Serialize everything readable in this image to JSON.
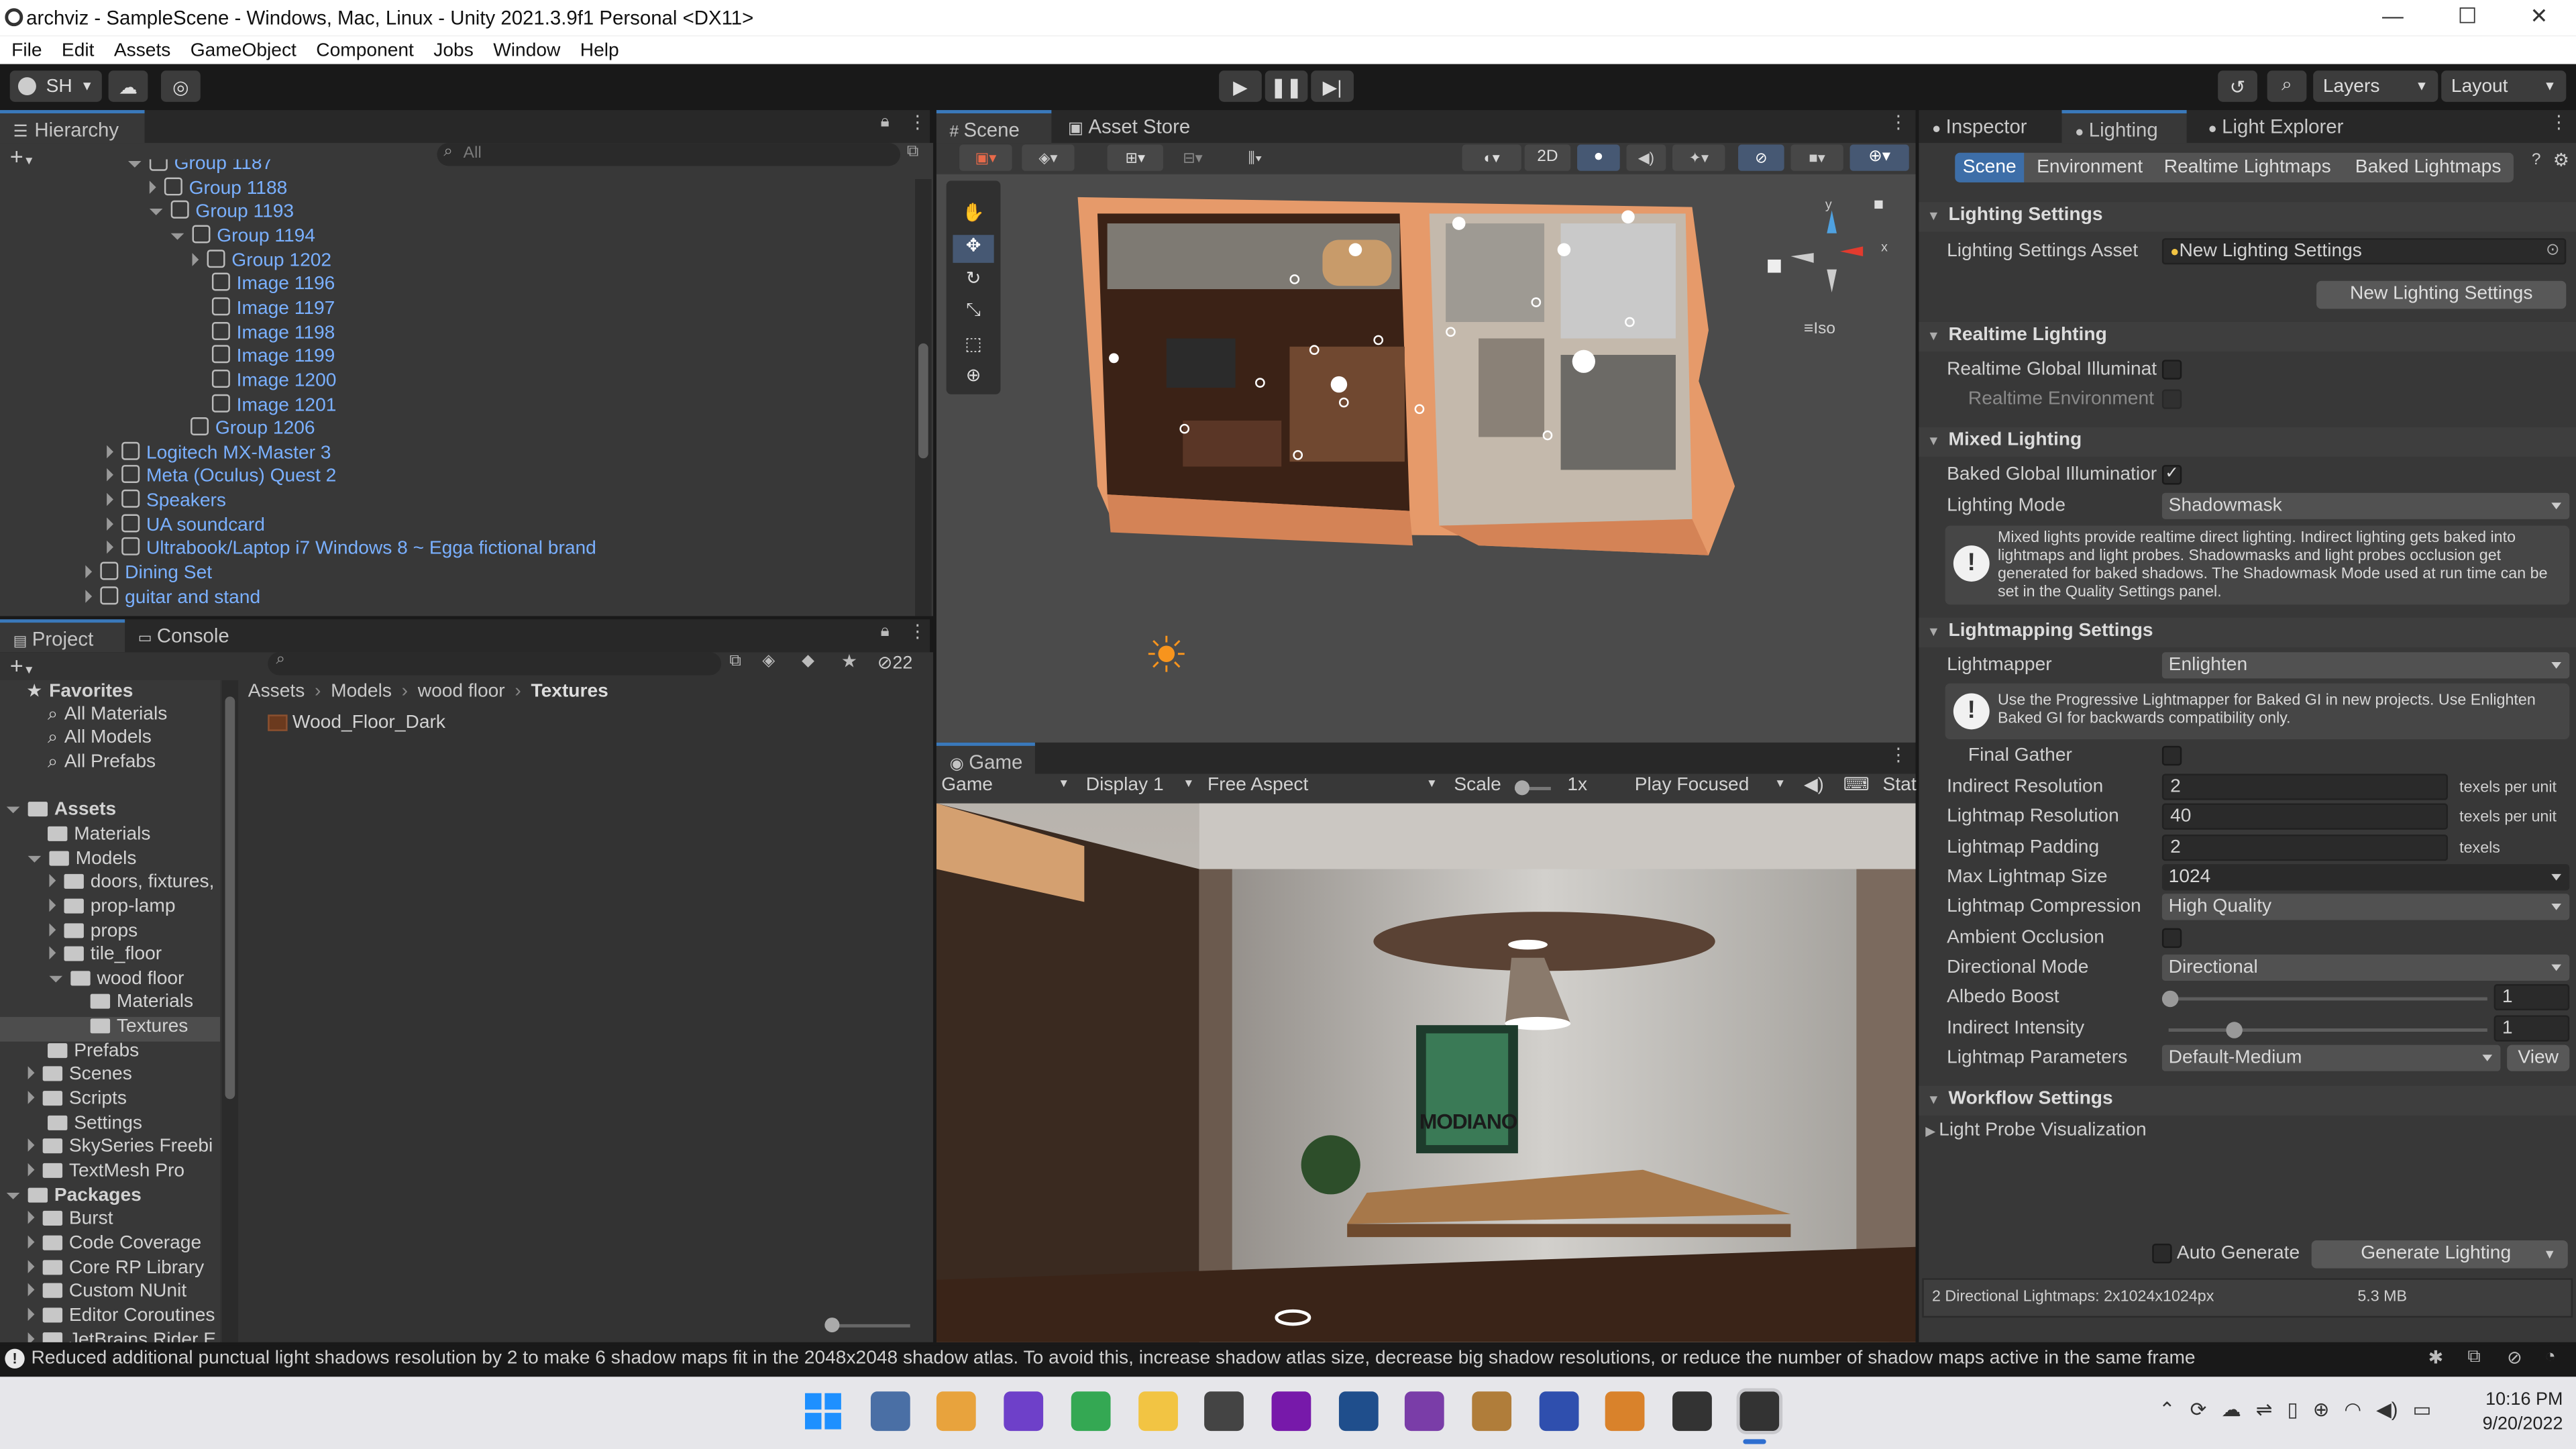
{
  "window": {
    "title": "archviz - SampleScene - Windows, Mac, Linux - Unity 2021.3.9f1 Personal <DX11>",
    "controls": [
      "—",
      "☐",
      "✕"
    ]
  },
  "menu": [
    "File",
    "Edit",
    "Assets",
    "GameObject",
    "Component",
    "Jobs",
    "Window",
    "Help"
  ],
  "toolbar": {
    "account": "SH",
    "layers": "Layers",
    "layout": "Layout"
  },
  "hierarchy": {
    "tab": "Hierarchy",
    "search_placeholder": "All",
    "items": [
      {
        "label": "Group 1187",
        "indent": 7,
        "expand": "down"
      },
      {
        "label": "Group 1188",
        "indent": 8,
        "expand": "right"
      },
      {
        "label": "Group 1193",
        "indent": 8,
        "expand": "down"
      },
      {
        "label": "Group 1194",
        "indent": 9,
        "expand": "down"
      },
      {
        "label": "Group 1202",
        "indent": 10,
        "expand": "right"
      },
      {
        "label": "Image 1196",
        "indent": 10,
        "expand": "none"
      },
      {
        "label": "Image 1197",
        "indent": 10,
        "expand": "none"
      },
      {
        "label": "Image 1198",
        "indent": 10,
        "expand": "none"
      },
      {
        "label": "Image 1199",
        "indent": 10,
        "expand": "none"
      },
      {
        "label": "Image 1200",
        "indent": 10,
        "expand": "none"
      },
      {
        "label": "Image 1201",
        "indent": 10,
        "expand": "none"
      },
      {
        "label": "Group 1206",
        "indent": 9,
        "expand": "none"
      },
      {
        "label": "Logitech MX-Master 3",
        "indent": 6,
        "expand": "right"
      },
      {
        "label": "Meta (Oculus) Quest 2",
        "indent": 6,
        "expand": "right"
      },
      {
        "label": "Speakers",
        "indent": 6,
        "expand": "right"
      },
      {
        "label": "UA soundcard",
        "indent": 6,
        "expand": "right"
      },
      {
        "label": "Ultrabook/Laptop i7 Windows 8 ~ Egga fictional brand",
        "indent": 6,
        "expand": "right"
      },
      {
        "label": "Dining Set",
        "indent": 5,
        "expand": "right"
      },
      {
        "label": "guitar and stand",
        "indent": 5,
        "expand": "right"
      }
    ]
  },
  "project": {
    "tabs": [
      "Project",
      "Console"
    ],
    "hidden_count": "22",
    "breadcrumb": [
      "Assets",
      "Models",
      "wood floor",
      "Textures"
    ],
    "files": [
      "Wood_Floor_Dark"
    ],
    "tree": [
      {
        "label": "Favorites",
        "indent": 0,
        "type": "star",
        "bold": true
      },
      {
        "label": "All Materials",
        "indent": 1,
        "type": "search"
      },
      {
        "label": "All Models",
        "indent": 1,
        "type": "search"
      },
      {
        "label": "All Prefabs",
        "indent": 1,
        "type": "search"
      },
      {
        "label": "",
        "indent": 0,
        "type": "gap"
      },
      {
        "label": "Assets",
        "indent": 0,
        "type": "folder",
        "bold": true,
        "expand": "down"
      },
      {
        "label": "Materials",
        "indent": 1,
        "type": "folder"
      },
      {
        "label": "Models",
        "indent": 1,
        "type": "folder",
        "expand": "down"
      },
      {
        "label": "doors, fixtures,",
        "indent": 2,
        "type": "folder",
        "expand": "right"
      },
      {
        "label": "prop-lamp",
        "indent": 2,
        "type": "folder",
        "expand": "right"
      },
      {
        "label": "props",
        "indent": 2,
        "type": "folder",
        "expand": "right"
      },
      {
        "label": "tile_floor",
        "indent": 2,
        "type": "folder",
        "expand": "right"
      },
      {
        "label": "wood floor",
        "indent": 2,
        "type": "folder",
        "expand": "down"
      },
      {
        "label": "Materials",
        "indent": 3,
        "type": "folder"
      },
      {
        "label": "Textures",
        "indent": 3,
        "type": "folder",
        "selected": true
      },
      {
        "label": "Prefabs",
        "indent": 1,
        "type": "folder"
      },
      {
        "label": "Scenes",
        "indent": 1,
        "type": "folder",
        "expand": "right"
      },
      {
        "label": "Scripts",
        "indent": 1,
        "type": "folder",
        "expand": "right"
      },
      {
        "label": "Settings",
        "indent": 1,
        "type": "folder"
      },
      {
        "label": "SkySeries Freebi",
        "indent": 1,
        "type": "folder",
        "expand": "right"
      },
      {
        "label": "TextMesh Pro",
        "indent": 1,
        "type": "folder",
        "expand": "right"
      },
      {
        "label": "Packages",
        "indent": 0,
        "type": "folder",
        "bold": true,
        "expand": "down"
      },
      {
        "label": "Burst",
        "indent": 1,
        "type": "folder",
        "expand": "right"
      },
      {
        "label": "Code Coverage",
        "indent": 1,
        "type": "folder",
        "expand": "right"
      },
      {
        "label": "Core RP Library",
        "indent": 1,
        "type": "folder",
        "expand": "right"
      },
      {
        "label": "Custom NUnit",
        "indent": 1,
        "type": "folder",
        "expand": "right"
      },
      {
        "label": "Editor Coroutines",
        "indent": 1,
        "type": "folder",
        "expand": "right"
      },
      {
        "label": "JetBrains Rider E",
        "indent": 1,
        "type": "folder",
        "expand": "right"
      }
    ]
  },
  "scene": {
    "tabs": [
      "Scene",
      "Asset Store"
    ],
    "toggle_2d": "2D",
    "gizmo_label": "Iso",
    "axis_y": "y",
    "axis_x": "x"
  },
  "game": {
    "tab": "Game",
    "display_mode": "Game",
    "display": "Display 1",
    "aspect": "Free Aspect",
    "scale_label": "Scale",
    "scale_value": "1x",
    "play_mode": "Play Focused",
    "stats": "Stat",
    "poster_text": "MODIANO"
  },
  "inspector": {
    "tabs": [
      "Inspector",
      "Lighting",
      "Light Explorer"
    ],
    "subtabs": [
      "Scene",
      "Environment",
      "Realtime Lightmaps",
      "Baked Lightmaps"
    ],
    "lighting_settings": {
      "header": "Lighting Settings",
      "asset_label": "Lighting Settings Asset",
      "asset_value": "New Lighting Settings",
      "new_button": "New Lighting Settings"
    },
    "realtime": {
      "header": "Realtime Lighting",
      "global_illum": "Realtime Global Illuminat",
      "environment": "Realtime Environment"
    },
    "mixed": {
      "header": "Mixed Lighting",
      "baked_gi": "Baked Global Illuminatior",
      "mode_label": "Lighting Mode",
      "mode_value": "Shadowmask",
      "help": "Mixed lights provide realtime direct lighting. Indirect lighting gets baked into lightmaps and light probes. Shadowmasks and light probes occlusion get generated for baked shadows. The Shadowmask Mode used at run time can be set in the Quality Settings panel."
    },
    "lightmapping": {
      "header": "Lightmapping Settings",
      "lightmapper_label": "Lightmapper",
      "lightmapper_value": "Enlighten",
      "help": "Use the Progressive Lightmapper for Baked GI in new projects. Use Enlighten Baked GI for backwards compatibility only.",
      "final_gather": "Final Gather",
      "indirect_res_label": "Indirect Resolution",
      "indirect_res_value": "2",
      "indirect_res_unit": "texels per unit",
      "lightmap_res_label": "Lightmap Resolution",
      "lightmap_res_value": "40",
      "lightmap_res_unit": "texels per unit",
      "padding_label": "Lightmap Padding",
      "padding_value": "2",
      "padding_unit": "texels",
      "max_size_label": "Max Lightmap Size",
      "max_size_value": "1024",
      "compression_label": "Lightmap Compression",
      "compression_value": "High Quality",
      "ao_label": "Ambient Occlusion",
      "dir_mode_label": "Directional Mode",
      "dir_mode_value": "Directional",
      "albedo_label": "Albedo Boost",
      "albedo_value": "1",
      "albedo_fraction": 0.0,
      "intensity_label": "Indirect Intensity",
      "intensity_value": "1",
      "intensity_fraction": 0.2,
      "params_label": "Lightmap Parameters",
      "params_value": "Default-Medium",
      "view_button": "View"
    },
    "workflow": {
      "header": "Workflow Settings",
      "probe_vis": "Light Probe Visualization"
    },
    "auto_generate": "Auto Generate",
    "generate_button": "Generate Lighting",
    "footer_left": "2 Directional Lightmaps: 2x1024x1024px",
    "footer_right": "5.3 MB"
  },
  "status": {
    "message": "Reduced additional punctual light shadows resolution by 2 to make 6 shadow maps fit in the 2048x2048 shadow atlas. To avoid this, increase shadow atlas size, decrease big shadow resolutions, or reduce the number of shadow maps active in the same frame"
  },
  "taskbar": {
    "time": "10:16 PM",
    "date": "9/20/2022",
    "apps": [
      {
        "name": "windows-start-icon",
        "color": "#1e90ff"
      },
      {
        "name": "calculator-icon",
        "color": "#4a6fa5"
      },
      {
        "name": "sourcetree-icon",
        "color": "#e8a33d"
      },
      {
        "name": "github-icon",
        "color": "#6e40c9"
      },
      {
        "name": "chrome-icon",
        "color": "#34a853"
      },
      {
        "name": "file-explorer-icon",
        "color": "#f2c443"
      },
      {
        "name": "unity-hub-icon",
        "color": "#444444"
      },
      {
        "name": "onenote-icon",
        "color": "#7719aa"
      },
      {
        "name": "substance-icon",
        "color": "#1f4e8c"
      },
      {
        "name": "affinity-photo-icon",
        "color": "#7a3da8"
      },
      {
        "name": "sonos-icon",
        "color": "#b07d3a"
      },
      {
        "name": "affinity-designer-icon",
        "color": "#2f4fae"
      },
      {
        "name": "chrome-dev-icon",
        "color": "#d9822b"
      },
      {
        "name": "unity-icon",
        "color": "#333333"
      },
      {
        "name": "unity-active-icon",
        "color": "#333333"
      }
    ]
  }
}
